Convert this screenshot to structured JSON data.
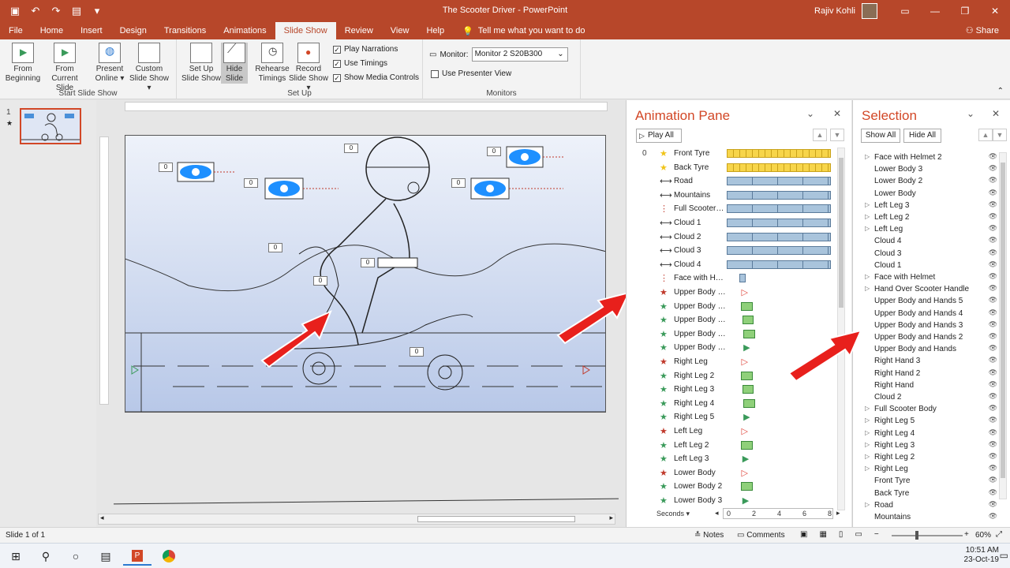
{
  "window": {
    "title": "The Scooter Driver  -  PowerPoint",
    "user_name": "Rajiv Kohli"
  },
  "tabs": [
    "File",
    "Home",
    "Insert",
    "Design",
    "Transitions",
    "Animations",
    "Slide Show",
    "Review",
    "View",
    "Help"
  ],
  "active_tab": "Slide Show",
  "tell_me": "Tell me what you want to do",
  "share": "Share",
  "ribbon": {
    "groups": {
      "start": "Start Slide Show",
      "setup": "Set Up",
      "monitors": "Monitors"
    },
    "buttons": {
      "from_beginning": "From Beginning",
      "from_current": "From Current Slide",
      "present_online": "Present Online ▾",
      "custom_slide_show": "Custom Slide Show ▾",
      "setup_show": "Set Up Slide Show",
      "hide_slide": "Hide Slide",
      "rehearse": "Rehearse Timings",
      "record": "Record Slide Show ▾"
    },
    "checks": {
      "play_narrations": "Play Narrations",
      "use_timings": "Use Timings",
      "show_media_controls": "Show Media Controls",
      "use_presenter_view": "Use Presenter View"
    },
    "monitor_label": "Monitor:",
    "monitor_value": "Monitor 2 S20B300"
  },
  "thumbnail": {
    "number": "1"
  },
  "animation_pane": {
    "title": "Animation Pane",
    "play_all": "Play All",
    "items": [
      {
        "num": "0",
        "icon": "★",
        "color": "#f0c419",
        "label": "Front Tyre",
        "bar": "yellow",
        "start": 0,
        "end": 1
      },
      {
        "num": "",
        "icon": "★",
        "color": "#f0c419",
        "label": "Back Tyre",
        "bar": "yellow",
        "start": 0,
        "end": 1
      },
      {
        "num": "",
        "icon": "⟷",
        "color": "#333333",
        "label": "Road",
        "bar": "blue",
        "start": 0,
        "end": 1
      },
      {
        "num": "",
        "icon": "⟷",
        "color": "#333333",
        "label": "Mountains",
        "bar": "blue",
        "start": 0,
        "end": 1
      },
      {
        "num": "",
        "icon": "⋮",
        "color": "#c0392b",
        "label": "Full Scooter B...",
        "bar": "blue",
        "start": 0,
        "end": 1
      },
      {
        "num": "",
        "icon": "⟷",
        "color": "#333333",
        "label": "Cloud 1",
        "bar": "blue",
        "start": 0,
        "end": 1
      },
      {
        "num": "",
        "icon": "⟷",
        "color": "#333333",
        "label": "Cloud 2",
        "bar": "blue",
        "start": 0,
        "end": 1
      },
      {
        "num": "",
        "icon": "⟷",
        "color": "#333333",
        "label": "Cloud 3",
        "bar": "blue",
        "start": 0,
        "end": 1
      },
      {
        "num": "",
        "icon": "⟷",
        "color": "#333333",
        "label": "Cloud 4",
        "bar": "blue",
        "start": 0,
        "end": 1
      },
      {
        "num": "",
        "icon": "⋮",
        "color": "#c0392b",
        "label": "Face with Hel...",
        "bar": "blue",
        "start": 0.12,
        "end": 0.18
      },
      {
        "num": "",
        "icon": "★",
        "color": "#c0392b",
        "label": "Upper Body a...",
        "bar": "red-tri",
        "start": 0.14,
        "end": 0.14
      },
      {
        "num": "",
        "icon": "★",
        "color": "#3a9a5a",
        "label": "Upper Body a...",
        "bar": "green",
        "start": 0.14,
        "end": 0.25
      },
      {
        "num": "",
        "icon": "★",
        "color": "#3a9a5a",
        "label": "Upper Body a...",
        "bar": "green",
        "start": 0.15,
        "end": 0.26
      },
      {
        "num": "",
        "icon": "★",
        "color": "#3a9a5a",
        "label": "Upper Body a...",
        "bar": "green",
        "start": 0.16,
        "end": 0.27
      },
      {
        "num": "",
        "icon": "★",
        "color": "#3a9a5a",
        "label": "Upper Body a...",
        "bar": "green-tri",
        "start": 0.16,
        "end": 0.16
      },
      {
        "num": "",
        "icon": "★",
        "color": "#c0392b",
        "label": "Right Leg",
        "bar": "red-tri",
        "start": 0.14,
        "end": 0.14
      },
      {
        "num": "",
        "icon": "★",
        "color": "#3a9a5a",
        "label": "Right Leg 2",
        "bar": "green",
        "start": 0.14,
        "end": 0.25
      },
      {
        "num": "",
        "icon": "★",
        "color": "#3a9a5a",
        "label": "Right Leg 3",
        "bar": "green",
        "start": 0.15,
        "end": 0.26
      },
      {
        "num": "",
        "icon": "★",
        "color": "#3a9a5a",
        "label": "Right Leg 4",
        "bar": "green",
        "start": 0.16,
        "end": 0.27
      },
      {
        "num": "",
        "icon": "★",
        "color": "#3a9a5a",
        "label": "Right Leg 5",
        "bar": "green-tri",
        "start": 0.16,
        "end": 0.16
      },
      {
        "num": "",
        "icon": "★",
        "color": "#c0392b",
        "label": "Left Leg",
        "bar": "red-tri",
        "start": 0.14,
        "end": 0.14
      },
      {
        "num": "",
        "icon": "★",
        "color": "#3a9a5a",
        "label": "Left Leg 2",
        "bar": "green",
        "start": 0.14,
        "end": 0.25
      },
      {
        "num": "",
        "icon": "★",
        "color": "#3a9a5a",
        "label": "Left Leg 3",
        "bar": "green-tri",
        "start": 0.15,
        "end": 0.15
      },
      {
        "num": "",
        "icon": "★",
        "color": "#c0392b",
        "label": "Lower Body",
        "bar": "red-tri",
        "start": 0.14,
        "end": 0.14
      },
      {
        "num": "",
        "icon": "★",
        "color": "#3a9a5a",
        "label": "Lower Body 2",
        "bar": "green",
        "start": 0.14,
        "end": 0.25
      },
      {
        "num": "",
        "icon": "★",
        "color": "#3a9a5a",
        "label": "Lower Body 3",
        "bar": "green-tri",
        "start": 0.15,
        "end": 0.15
      }
    ],
    "timeline": {
      "seconds_label": "Seconds ▾",
      "ticks": [
        "0",
        "2",
        "4",
        "6",
        "8"
      ]
    }
  },
  "selection_pane": {
    "title": "Selection",
    "show_all": "Show All",
    "hide_all": "Hide All",
    "items": [
      {
        "expand": "▷",
        "label": "Face with Helmet 2"
      },
      {
        "expand": "",
        "label": "Lower Body 3"
      },
      {
        "expand": "",
        "label": "Lower Body 2"
      },
      {
        "expand": "",
        "label": "Lower Body"
      },
      {
        "expand": "▷",
        "label": "Left Leg 3"
      },
      {
        "expand": "▷",
        "label": "Left Leg 2"
      },
      {
        "expand": "▷",
        "label": "Left Leg"
      },
      {
        "expand": "",
        "label": "Cloud 4"
      },
      {
        "expand": "",
        "label": "Cloud 3"
      },
      {
        "expand": "",
        "label": "Cloud 1"
      },
      {
        "expand": "▷",
        "label": "Face with Helmet"
      },
      {
        "expand": "▷",
        "label": "Hand Over Scooter Handle"
      },
      {
        "expand": "",
        "label": "Upper Body and Hands 5"
      },
      {
        "expand": "",
        "label": "Upper Body and Hands 4"
      },
      {
        "expand": "",
        "label": "Upper Body and Hands 3"
      },
      {
        "expand": "",
        "label": "Upper Body and Hands 2"
      },
      {
        "expand": "",
        "label": "Upper Body and Hands"
      },
      {
        "expand": "",
        "label": "Right Hand 3"
      },
      {
        "expand": "",
        "label": "Right Hand 2"
      },
      {
        "expand": "",
        "label": "Right Hand"
      },
      {
        "expand": "",
        "label": "Cloud 2"
      },
      {
        "expand": "▷",
        "label": "Full Scooter Body"
      },
      {
        "expand": "▷",
        "label": "Right Leg 5"
      },
      {
        "expand": "▷",
        "label": "Right Leg 4"
      },
      {
        "expand": "▷",
        "label": "Right Leg 3"
      },
      {
        "expand": "▷",
        "label": "Right Leg 2"
      },
      {
        "expand": "▷",
        "label": "Right Leg"
      },
      {
        "expand": "",
        "label": "Front Tyre"
      },
      {
        "expand": "",
        "label": "Back Tyre"
      },
      {
        "expand": "▷",
        "label": "Road"
      },
      {
        "expand": "",
        "label": "Mountains"
      }
    ]
  },
  "status": {
    "slide_count": "Slide 1 of 1",
    "notes": "Notes",
    "comments": "Comments",
    "zoom": "60%"
  },
  "clock": {
    "time": "10:51 AM",
    "date": "23-Oct-19"
  },
  "colors": {
    "accent": "#b7472a",
    "pane_title": "#d24726",
    "bar_yellow": "#f7d54a",
    "bar_blue": "#a9c4dc",
    "bar_green": "#8fd07a",
    "arrow_red": "#e8201c"
  }
}
